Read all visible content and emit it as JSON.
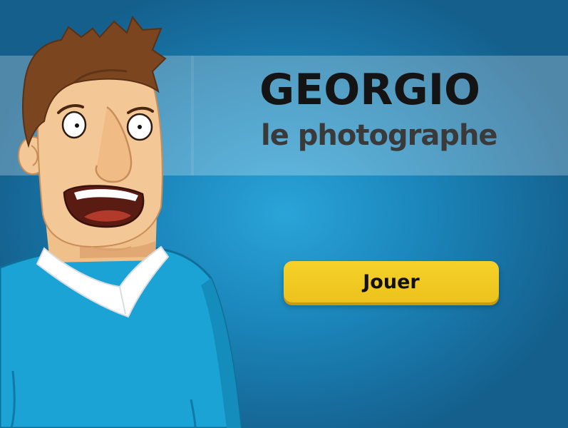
{
  "game": {
    "title": "GEORGIO",
    "subtitle": "le photographe"
  },
  "menu": {
    "play_label": "Jouer"
  },
  "colors": {
    "background": "#1b86bb",
    "button": "#f0c823",
    "sweater": "#1ba3d6",
    "hair": "#7b4520",
    "skin": "#f4c896"
  },
  "icons": {
    "character": "cartoon-man-georgio"
  }
}
